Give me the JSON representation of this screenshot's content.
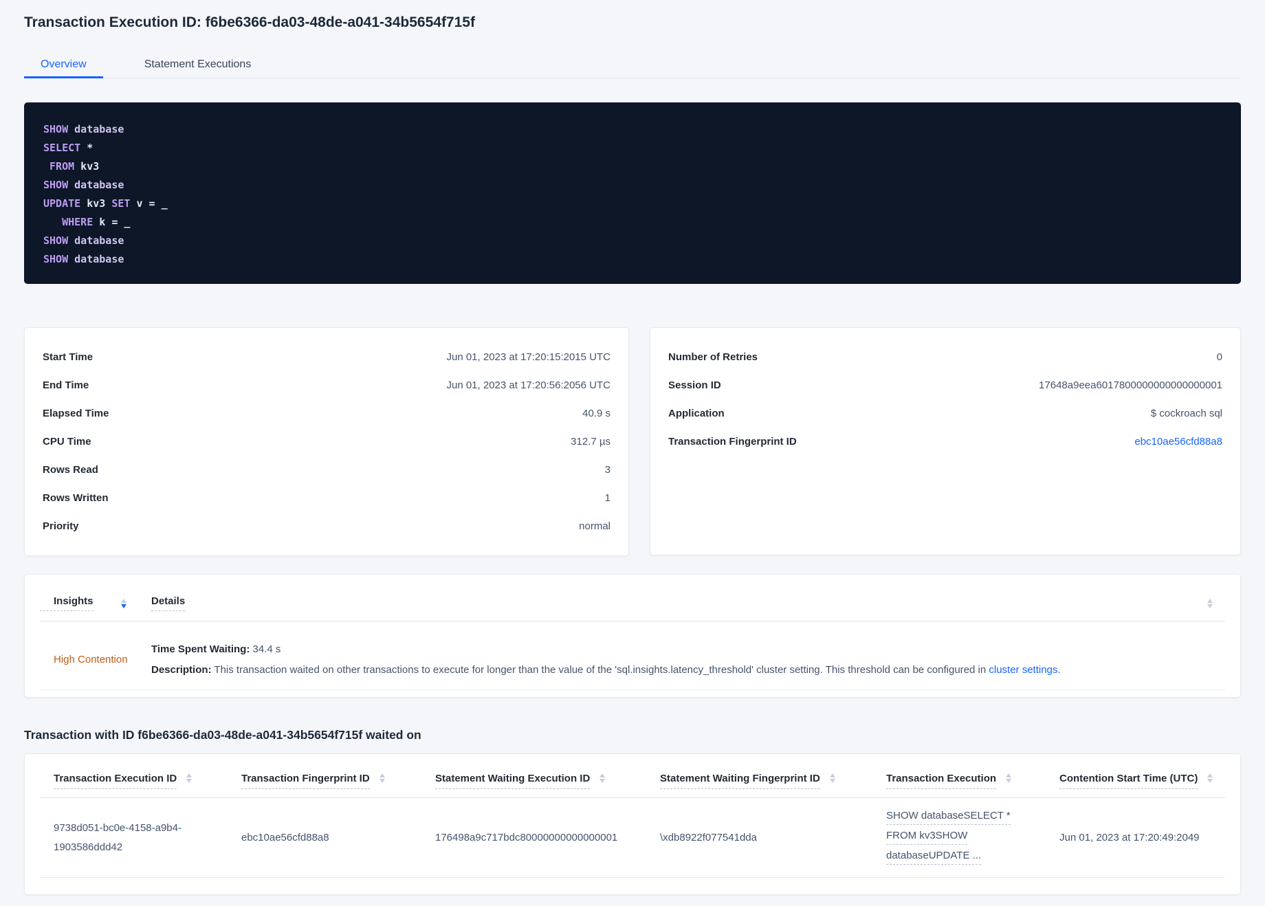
{
  "colors": {
    "accent": "#1664ff",
    "warning": "#c05b12",
    "code_bg": "#0d1727",
    "code_kw": "#bd9cf1",
    "code_kw2": "#d0c5f4",
    "code_plain": "#e5e8f3"
  },
  "header": {
    "title": "Transaction Execution ID: f6be6366-da03-48de-a041-34b5654f715f",
    "tabs": [
      {
        "label": "Overview",
        "active": true
      },
      {
        "label": "Statement Executions",
        "active": false
      }
    ]
  },
  "sql_box": {
    "lines": [
      [
        [
          "kw",
          "SHOW"
        ],
        [
          "pl",
          " "
        ],
        [
          "kw2",
          "database"
        ]
      ],
      [
        [
          "kw",
          "SELECT"
        ],
        [
          "pl",
          " *"
        ]
      ],
      [
        [
          "pl",
          " "
        ],
        [
          "kw",
          "FROM"
        ],
        [
          "pl",
          " kv3"
        ]
      ],
      [
        [
          "kw",
          "SHOW"
        ],
        [
          "pl",
          " "
        ],
        [
          "kw2",
          "database"
        ]
      ],
      [
        [
          "kw",
          "UPDATE"
        ],
        [
          "pl",
          " kv3 "
        ],
        [
          "kw",
          "SET"
        ],
        [
          "pl",
          " v = _"
        ]
      ],
      [
        [
          "pl",
          "   "
        ],
        [
          "kw",
          "WHERE"
        ],
        [
          "pl",
          " k = _"
        ]
      ],
      [
        [
          "kw",
          "SHOW"
        ],
        [
          "pl",
          " "
        ],
        [
          "kw2",
          "database"
        ]
      ],
      [
        [
          "kw",
          "SHOW"
        ],
        [
          "pl",
          " "
        ],
        [
          "kw2",
          "database"
        ]
      ]
    ]
  },
  "summary_left": {
    "rows": [
      {
        "label": "Start Time",
        "value": "Jun 01, 2023 at 17:20:15:2015 UTC"
      },
      {
        "label": "End Time",
        "value": "Jun 01, 2023 at 17:20:56:2056 UTC"
      },
      {
        "label": "Elapsed Time",
        "value": "40.9 s"
      },
      {
        "label": "CPU Time",
        "value": "312.7 µs"
      },
      {
        "label": "Rows Read",
        "value": "3"
      },
      {
        "label": "Rows Written",
        "value": "1"
      },
      {
        "label": "Priority",
        "value": "normal"
      }
    ]
  },
  "summary_right": {
    "rows": [
      {
        "label": "Number of Retries",
        "value": "0"
      },
      {
        "label": "Session ID",
        "value": "17648a9eea6017800000000000000001"
      },
      {
        "label": "Application",
        "value": "$ cockroach sql"
      },
      {
        "label": "Transaction Fingerprint ID",
        "value": "ebc10ae56cfd88a8"
      }
    ]
  },
  "insights": {
    "columns": [
      {
        "label": "Insights"
      },
      {
        "label": "Details"
      }
    ],
    "row": {
      "insight": "High Contention",
      "waiting_label": "Time Spent Waiting:",
      "waiting_value": "34.4 s",
      "description_label": "Description:",
      "description_text": "This transaction waited on other transactions to execute for longer than the value of the 'sql.insights.latency_threshold' cluster setting. This threshold can be configured in ",
      "description_link": "cluster settings",
      "description_suffix": "."
    }
  },
  "waited_on": {
    "heading": "Transaction with ID f6be6366-da03-48de-a041-34b5654f715f waited on",
    "columns": [
      "Transaction Execution ID",
      "Transaction Fingerprint ID",
      "Statement Waiting Execution ID",
      "Statement Waiting Fingerprint ID",
      "Transaction Execution",
      "Contention Start Time (UTC)"
    ],
    "row": {
      "transaction_execution_id": "9738d051-bc0e-4158-a9b4-1903586ddd42",
      "transaction_fingerprint_id": "ebc10ae56cfd88a8",
      "statement_waiting_execution_id": "176498a9c717bdc80000000000000001",
      "statement_waiting_fingerprint_id": "\\xdb8922f077541dda",
      "transaction_execution_lines": [
        "SHOW databaseSELECT *",
        "FROM kv3SHOW",
        "databaseUPDATE ..."
      ],
      "contention_start_time": "Jun 01, 2023 at 17:20:49:2049"
    }
  }
}
